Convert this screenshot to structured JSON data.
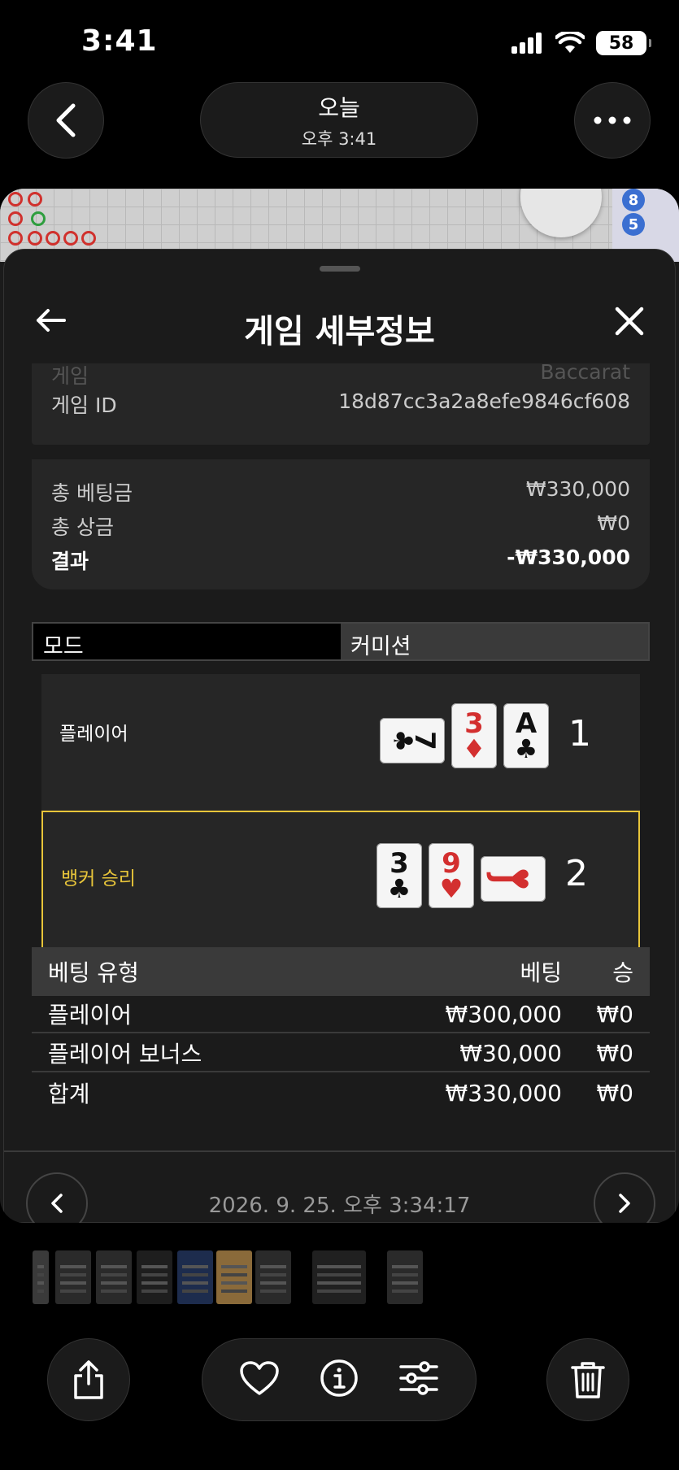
{
  "status_bar": {
    "time": "3:41",
    "battery": "58"
  },
  "photos_nav": {
    "title": "오늘",
    "subtitle": "오후 3:41"
  },
  "roadmap": {
    "numbers": [
      "8",
      "5"
    ]
  },
  "sheet": {
    "title": "게임 세부정보",
    "game_row": {
      "label": "게임",
      "value": "Baccarat"
    },
    "game_id_row": {
      "label": "게임 ID",
      "value": "18d87cc3a2a8efe9846cf608"
    },
    "summary": [
      {
        "label": "총 베팅금",
        "value": "₩330,000"
      },
      {
        "label": "총 상금",
        "value": "₩0"
      },
      {
        "label": "결과",
        "value": "-₩330,000"
      }
    ],
    "tabs": [
      {
        "label": "모드"
      },
      {
        "label": "커미션"
      }
    ],
    "hands": {
      "player": {
        "label": "플레이어",
        "score": "1",
        "cards": [
          {
            "rank": "7",
            "suit": "♣",
            "color": "black",
            "rotated": true
          },
          {
            "rank": "3",
            "suit": "♦",
            "color": "red",
            "rotated": false
          },
          {
            "rank": "A",
            "suit": "♣",
            "color": "black",
            "rotated": false
          }
        ]
      },
      "banker": {
        "label": "뱅커 승리",
        "score": "2",
        "highlight_color": "#e8c53a",
        "cards": [
          {
            "rank": "3",
            "suit": "♣",
            "color": "black",
            "rotated": false
          },
          {
            "rank": "9",
            "suit": "♥",
            "color": "red",
            "rotated": false
          },
          {
            "rank": "J",
            "suit": "♥",
            "color": "red",
            "rotated": true
          }
        ]
      }
    },
    "bets_table": {
      "headers": {
        "type": "베팅 유형",
        "bet": "베팅",
        "win": "승"
      },
      "rows": [
        {
          "type": "플레이어",
          "bet": "₩300,000",
          "win": "₩0"
        },
        {
          "type": "플레이어 보너스",
          "bet": "₩30,000",
          "win": "₩0"
        },
        {
          "type": "합계",
          "bet": "₩330,000",
          "win": "₩0"
        }
      ]
    },
    "timestamp": "2026. 9. 25. 오후 3:34:17"
  }
}
